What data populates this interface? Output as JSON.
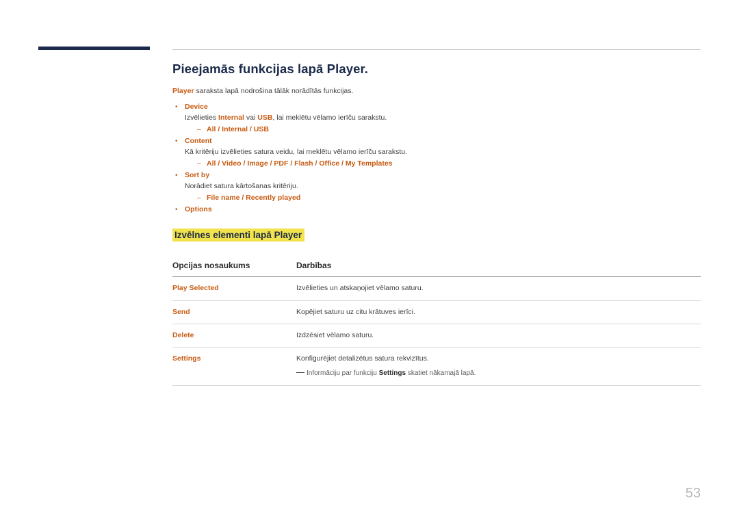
{
  "page": {
    "number": "53"
  },
  "heading": {
    "title": "Pieejamās funkcijas lapā Player.",
    "intro_bold": "Player",
    "intro_rest": " saraksta lapā nodrošina tālāk norādītās funkcijas."
  },
  "bullets": [
    {
      "label": "Device",
      "desc_parts": [
        {
          "text": "Izvēlieties ",
          "style": "normal"
        },
        {
          "text": "Internal",
          "style": "bold"
        },
        {
          "text": " vai ",
          "style": "normal"
        },
        {
          "text": "USB",
          "style": "bold"
        },
        {
          "text": ", lai meklētu vēlamo ierīču sarakstu.",
          "style": "normal"
        }
      ],
      "options": "All / Internal / USB"
    },
    {
      "label": "Content",
      "desc_parts": [
        {
          "text": "Kā kritēriju izvēlieties satura veidu, lai meklētu vēlamo ierīču sarakstu.",
          "style": "normal"
        }
      ],
      "options": "All / Video / Image / PDF / Flash / Office / My Templates"
    },
    {
      "label": "Sort by",
      "desc_parts": [
        {
          "text": "Norādiet satura kārtošanas kritēriju.",
          "style": "normal"
        }
      ],
      "options": "File name / Recently played"
    },
    {
      "label": "Options",
      "desc_parts": [],
      "options": ""
    }
  ],
  "section": {
    "highlight_heading": "Izvēlnes elementi lapā Player"
  },
  "table": {
    "headers": {
      "col1": "Opcijas nosaukums",
      "col2": "Darbības"
    },
    "rows": [
      {
        "name": "Play Selected",
        "desc": "Izvēlieties un atskaņojiet vēlamo saturu."
      },
      {
        "name": "Send",
        "desc": "Kopējiet saturu uz citu krātuves ierīci."
      },
      {
        "name": "Delete",
        "desc": "Izdzēsiet vēlamo saturu."
      },
      {
        "name": "Settings",
        "desc": "Konfigurējiet detalizētus satura rekvizītus.",
        "note_pre": "Informāciju par funkciju ",
        "note_bold": "Settings",
        "note_post": " skatiet nākamajā lapā."
      }
    ]
  }
}
